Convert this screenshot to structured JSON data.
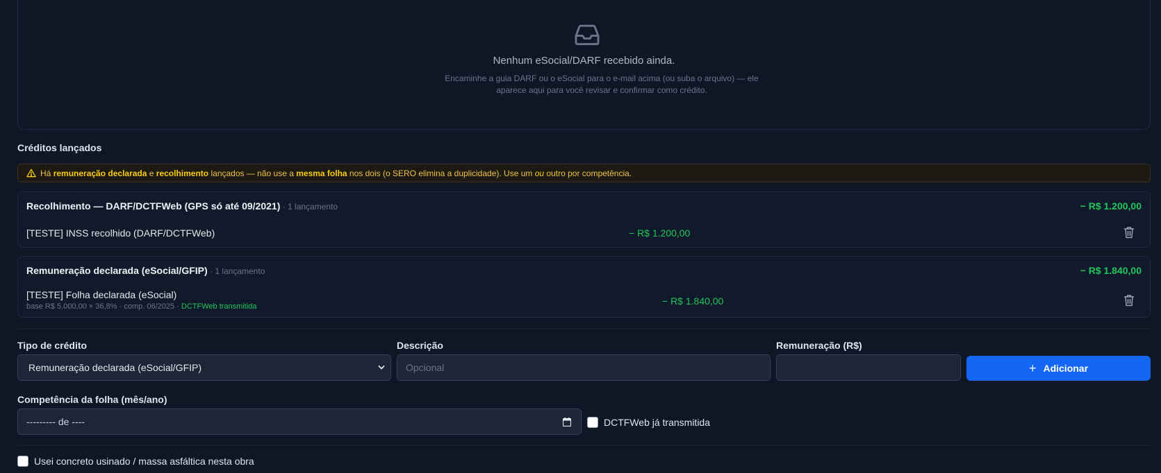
{
  "inbox": {
    "title": "Nenhum eSocial/DARF recebido ainda.",
    "description": "Encaminhe a guia DARF ou o eSocial para o e-mail acima (ou suba o arquivo) — ele aparece aqui para você revisar e confirmar como crédito.",
    "icon": "inbox-icon"
  },
  "credits": {
    "title": "Créditos lançados",
    "warning": {
      "p1": "Há ",
      "b1": "remuneração declarada",
      "p2": " e ",
      "b2": "recolhimento",
      "p3": " lançados — não use a ",
      "b3": "mesma folha",
      "p4": " nos dois (o SERO elimina a duplicidade). Use um ",
      "i1": "ou",
      "p5": " outro por competência."
    },
    "groups": [
      {
        "title": "Recolhimento — DARF/DCTFWeb (GPS só até 09/2021)",
        "count": " · 1 lançamento",
        "total": "− R$ 1.200,00",
        "items": [
          {
            "label": "[TESTE] INSS recolhido (DARF/DCTFWeb)",
            "amount": "− R$ 1.200,00"
          }
        ]
      },
      {
        "title": "Remuneração declarada (eSocial/GFIP)",
        "count": " · 1 lançamento",
        "total": "− R$ 1.840,00",
        "items": [
          {
            "label": "[TESTE] Folha declarada (eSocial)",
            "sub": "base R$ 5.000,00 × 36,8% · comp. 06/2025 · ",
            "sub_status": "DCTFWeb transmitida",
            "amount": "− R$ 1.840,00"
          }
        ]
      }
    ]
  },
  "form": {
    "type_label": "Tipo de crédito",
    "type_value": "Remuneração declarada (eSocial/GFIP)",
    "desc_label": "Descrição",
    "desc_placeholder": "Opcional",
    "rem_label": "Remuneração (R$)",
    "add_label": "Adicionar",
    "comp_label": "Competência da folha (mês/ano)",
    "comp_placeholder": "--------- de ----",
    "dctf_label": "DCTFWeb já transmitida",
    "concrete_label": "Usei concreto usinado / massa asfáltica nesta obra"
  },
  "colors": {
    "accent": "#1466f5",
    "positive": "#22c55e",
    "warning": "#facc15"
  }
}
